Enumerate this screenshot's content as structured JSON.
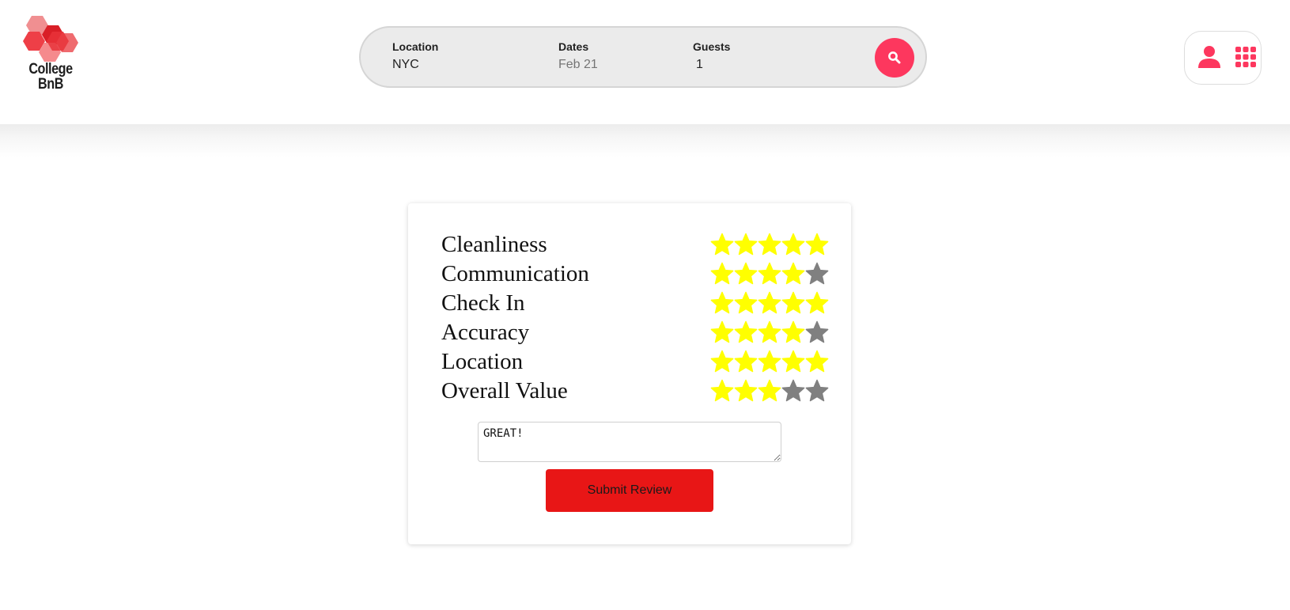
{
  "app": {
    "logo_text_line1": "College",
    "logo_text_line2": "BnB"
  },
  "search": {
    "location_label": "Location",
    "location_value": "NYC",
    "dates_label": "Dates",
    "dates_value": "Feb 21",
    "guests_label": "Guests",
    "guests_value": "1",
    "button_icon": "search-icon"
  },
  "user_menu": {
    "icons": [
      "user-icon",
      "grid-menu-icon"
    ]
  },
  "review": {
    "max_stars": 5,
    "ratings": [
      {
        "label": "Cleanliness",
        "value": 5
      },
      {
        "label": "Communication",
        "value": 4
      },
      {
        "label": "Check In",
        "value": 5
      },
      {
        "label": "Accuracy",
        "value": 4
      },
      {
        "label": "Location",
        "value": 5
      },
      {
        "label": "Overall Value",
        "value": 3
      }
    ],
    "comment_value": "GREAT!",
    "submit_label": "Submit Review"
  },
  "colors": {
    "brand_accent": "#fd375e",
    "star_filled": "#ffff00",
    "star_empty": "#808080",
    "submit_button": "#e81616"
  }
}
